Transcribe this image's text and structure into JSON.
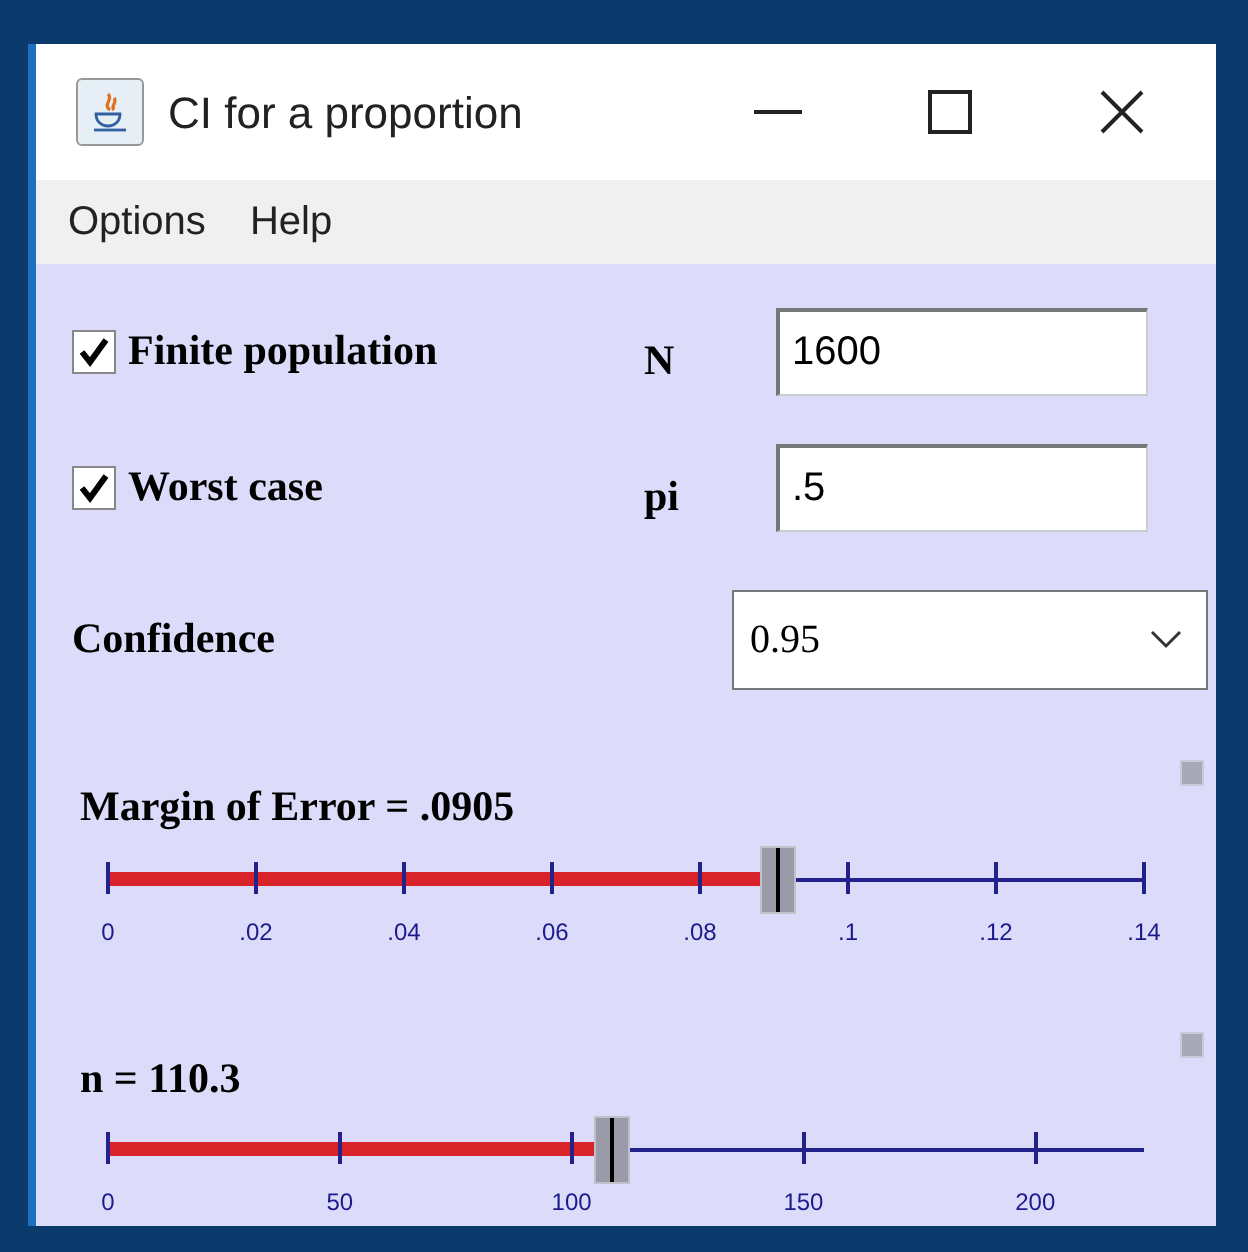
{
  "window": {
    "title": "CI for a proportion"
  },
  "menu": [
    "Options",
    "Help"
  ],
  "options": [
    {
      "label": "Finite population",
      "checked": true,
      "field_label": "N",
      "value": "1600"
    },
    {
      "label": "Worst case",
      "checked": true,
      "field_label": "pi",
      "value": ".5"
    }
  ],
  "confidence": {
    "label": "Confidence",
    "value": "0.95"
  },
  "sliders": [
    {
      "label": "Margin of Error = .0905",
      "level": 0.646,
      "ticks": [
        "0",
        ".02",
        ".04",
        ".06",
        ".08",
        ".1",
        ".12",
        ".14"
      ]
    },
    {
      "label": "n = 110.3",
      "level": 0.487,
      "ticks": [
        "0",
        "50",
        "100",
        "150",
        "200"
      ]
    }
  ]
}
